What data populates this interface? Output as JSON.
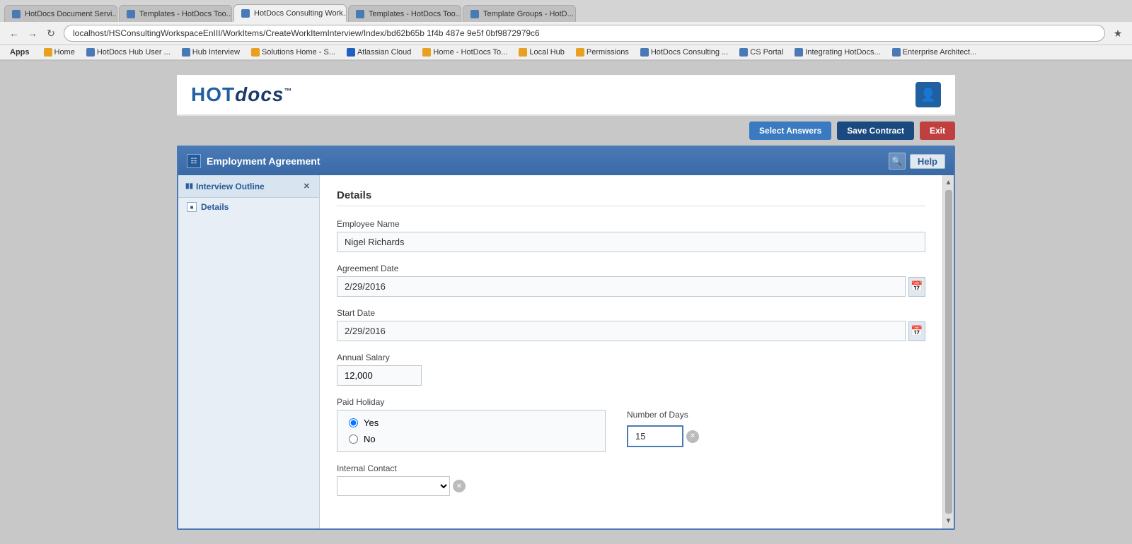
{
  "browser": {
    "address": "localhost/HSConsultingWorkspaceEnIII/WorkItems/CreateWorkItemInterview/Index/bd62b65b 1f4b 487e 9e5f 0bf9872979c6",
    "tabs": [
      {
        "id": "tab1",
        "label": "HotDocs Document Servi...",
        "active": false,
        "closeable": true
      },
      {
        "id": "tab2",
        "label": "Templates - HotDocs Too...",
        "active": false,
        "closeable": true
      },
      {
        "id": "tab3",
        "label": "HotDocs Consulting Work...",
        "active": true,
        "closeable": true
      },
      {
        "id": "tab4",
        "label": "Templates - HotDocs Too...",
        "active": false,
        "closeable": true
      },
      {
        "id": "tab5",
        "label": "Template Groups - HotD...",
        "active": false,
        "closeable": true
      }
    ],
    "bookmarks": [
      {
        "id": "bm1",
        "label": "Apps"
      },
      {
        "id": "bm2",
        "label": "Home",
        "icon": "orange"
      },
      {
        "id": "bm3",
        "label": "HotDocs Hub User ...",
        "icon": "blue"
      },
      {
        "id": "bm4",
        "label": "Hub Interview",
        "icon": "blue"
      },
      {
        "id": "bm5",
        "label": "Solutions Home - S...",
        "icon": "orange"
      },
      {
        "id": "bm6",
        "label": "Atlassian Cloud",
        "icon": "blue2"
      },
      {
        "id": "bm7",
        "label": "Home - HotDocs To...",
        "icon": "orange"
      },
      {
        "id": "bm8",
        "label": "Local Hub",
        "icon": "orange"
      },
      {
        "id": "bm9",
        "label": "Permissions",
        "icon": "orange"
      },
      {
        "id": "bm10",
        "label": "HotDocs Consulting ...",
        "icon": "blue"
      },
      {
        "id": "bm11",
        "label": "CS Portal",
        "icon": "blue"
      },
      {
        "id": "bm12",
        "label": "Integrating HotDocs...",
        "icon": "blue"
      },
      {
        "id": "bm13",
        "label": "Enterprise Architect...",
        "icon": "blue"
      }
    ]
  },
  "header": {
    "logo_hot": "HOT",
    "logo_docs": "docs",
    "logo_tm": "™"
  },
  "toolbar": {
    "select_answers_label": "Select Answers",
    "save_contract_label": "Save Contract",
    "exit_label": "Exit"
  },
  "interview": {
    "title": "Employment Agreement",
    "help_label": "Help",
    "sidebar_title": "Interview Outline",
    "sidebar_items": [
      {
        "id": "details",
        "label": "Details",
        "active": true
      }
    ]
  },
  "form": {
    "section_title": "Details",
    "fields": {
      "employee_name": {
        "label": "Employee Name",
        "value": "Nigel Richards",
        "placeholder": ""
      },
      "agreement_date": {
        "label": "Agreement Date",
        "value": "2/29/2016"
      },
      "start_date": {
        "label": "Start Date",
        "value": "2/29/2016"
      },
      "annual_salary": {
        "label": "Annual Salary",
        "value": "12,000"
      },
      "paid_holiday": {
        "label": "Paid Holiday",
        "options": [
          {
            "id": "yes",
            "label": "Yes",
            "checked": true
          },
          {
            "id": "no",
            "label": "No",
            "checked": false
          }
        ]
      },
      "number_of_days": {
        "label": "Number of Days",
        "value": "15"
      },
      "internal_contact": {
        "label": "Internal Contact",
        "value": "",
        "placeholder": ""
      }
    }
  },
  "icons": {
    "calendar": "📅",
    "clear": "✕",
    "search": "🔍",
    "user": "👤",
    "scroll_up": "▲",
    "scroll_down": "▼",
    "collapse": "−",
    "close": "✕",
    "folder": "📁"
  }
}
